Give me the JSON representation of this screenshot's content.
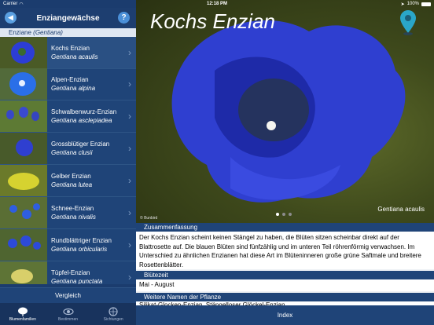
{
  "status": {
    "carrier": "Carrier",
    "time": "12:18 PM",
    "battery": "100%"
  },
  "nav": {
    "title": "Enziangewächse",
    "back_icon": "back-arrow-icon",
    "help_label": "?"
  },
  "section": {
    "name": "Enziane",
    "latin": "(Gentiana)"
  },
  "list": [
    {
      "name": "Kochs Enzian",
      "latin": "Gentiana acaulis"
    },
    {
      "name": "Alpen-Enzian",
      "latin": "Gentiana alpina"
    },
    {
      "name": "Schwalbenwurz-Enzian",
      "latin": "Gentiana asclepiadea"
    },
    {
      "name": "Grossblütiger Enzian",
      "latin": "Gentiana clusii"
    },
    {
      "name": "Gelber Enzian",
      "latin": "Gentiana lutea"
    },
    {
      "name": "Schnee-Enzian",
      "latin": "Gentiana nivalis"
    },
    {
      "name": "Rundblättriger Enzian",
      "latin": "Gentiana orbicularis"
    },
    {
      "name": "Tüpfel-Enzian",
      "latin": "Gentiana punctata"
    }
  ],
  "compare_label": "Vergleich",
  "tabs": [
    {
      "label": "Blumenfamilien",
      "icon": "flower-icon"
    },
    {
      "label": "Bestimmen",
      "icon": "eye-icon"
    },
    {
      "label": "Sichtungen",
      "icon": "globe-icon"
    }
  ],
  "detail": {
    "title": "Kochs Enzian",
    "caption": "Gentiana acaulis",
    "credit": "© Bunbird",
    "summary_header": "Zusammenfassung",
    "summary": "Der Kochs Enzian scheint keinen Stängel zu haben, die Blüten sitzen scheinbar direkt auf der Blattrosette auf. Die blauen Blüten sind fünfzählig und im unteren Teil röhrenförmig verwachsen. Im Unterschied zu ähnlichen Enzianen hat diese Art im Blüteninneren große grüne Saftmale und breitere Rosettenblätter.",
    "bloom_header": "Blütezeit",
    "bloom": "Mai - August",
    "names_header": "Weitere Namen der Pflanze",
    "names": "Silikat-Glocken-Enzian, Stängelloser Glöckel-Enzian",
    "index_label": "Index"
  },
  "colors": {
    "nav": "#1d3e70",
    "list": "#1f4478",
    "accent": "#5a9fe0",
    "flower": "#2f3fd0"
  }
}
